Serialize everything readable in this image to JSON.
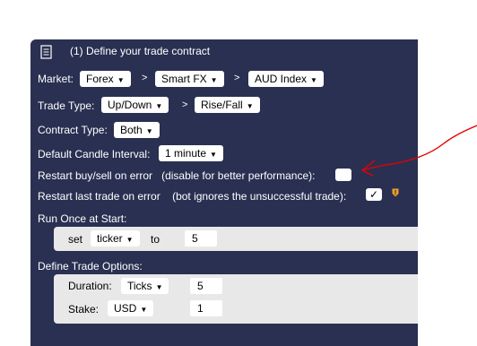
{
  "header": {
    "title": "(1) Define your trade contract",
    "icon": "document-list-icon"
  },
  "market": {
    "label": "Market:",
    "sep": ">",
    "forex": "Forex",
    "smart_fx": "Smart FX",
    "aud_index": "AUD Index"
  },
  "trade_type": {
    "label": "Trade Type:",
    "sep": ">",
    "up_down": "Up/Down",
    "rise_fall": "Rise/Fall"
  },
  "contract_type": {
    "label": "Contract Type:",
    "value": "Both"
  },
  "candle": {
    "label": "Default Candle Interval:",
    "value": "1 minute"
  },
  "restart_buy_sell": {
    "label": "Restart buy/sell on error",
    "hint": "(disable for better performance):",
    "checked": false
  },
  "restart_last": {
    "label": "Restart last trade on error",
    "hint": "(bot ignores the unsuccessful trade):",
    "check_mark": "✓",
    "checked": true,
    "warning_icon": "shield-warning-icon"
  },
  "run_once": {
    "label": "Run Once at Start:",
    "set": "set",
    "variable": "ticker",
    "to": "to",
    "value": "5"
  },
  "trade_options": {
    "label": "Define Trade Options:",
    "duration_label": "Duration:",
    "duration_unit": "Ticks",
    "duration_value": "5",
    "stake_label": "Stake:",
    "currency": "USD",
    "stake_value": "1"
  },
  "colors": {
    "block": "#2a3052",
    "subblock": "#e8e8e8",
    "annotation": "#e60000",
    "warning": "#f0a020"
  }
}
